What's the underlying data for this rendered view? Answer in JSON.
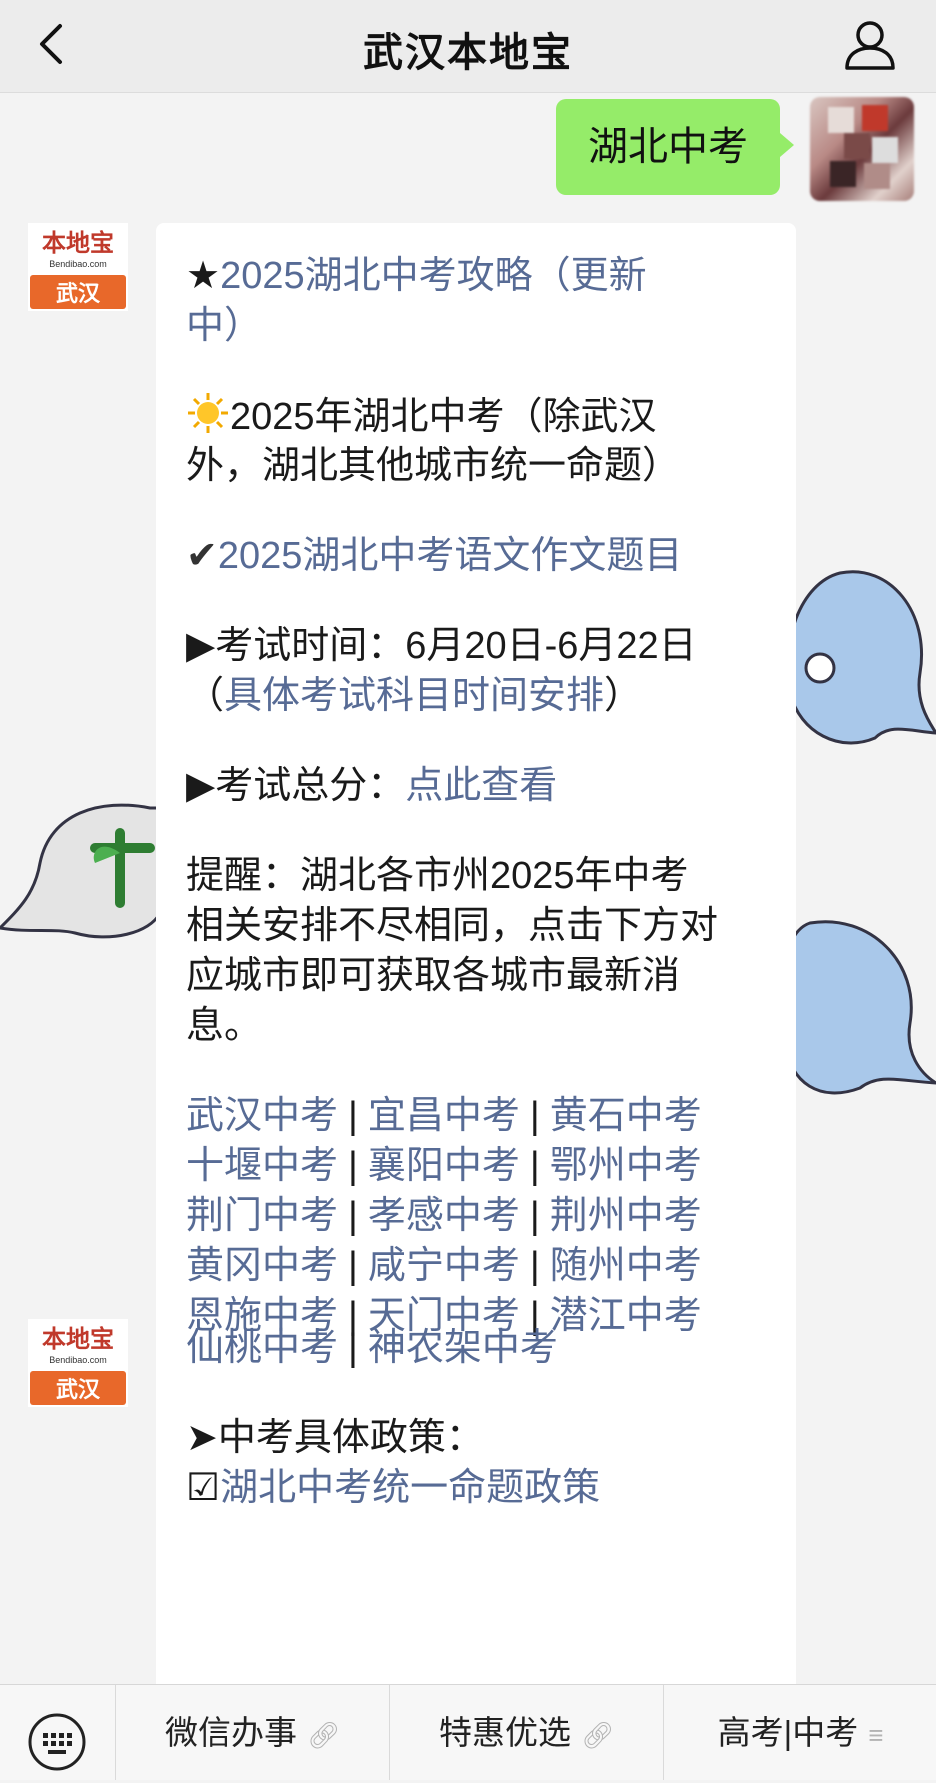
{
  "header": {
    "title": "武汉本地宝"
  },
  "user_message": {
    "text": "湖北中考"
  },
  "bot_avatar": {
    "brand": "本地宝",
    "domain": "Bendibao.com",
    "city": "武汉"
  },
  "message1": {
    "star": "★",
    "guide_link": "2025湖北中考攻略（更新",
    "guide_link_cont": "中）",
    "sun_icon": "sun-emoji",
    "line2a": "2025年湖北中考（除武汉",
    "line2b": "外，湖北其他城市统一命题）",
    "check_icon": "✔",
    "essay_link": "2025湖北中考语文作文题目",
    "time_label": "▶考试时间：6月20日-6月22日",
    "paren_open": "（",
    "schedule_link": "具体考试科目时间安排",
    "paren_close": "）",
    "score_label": "▶考试总分：",
    "score_link": "点此查看",
    "reminder_1": "提醒：湖北各市州2025年中考",
    "reminder_2": "相关安排不尽相同，点击下方对",
    "reminder_3": "应城市即可获取各城市最新消",
    "reminder_4": "息。",
    "separator": "|",
    "cities": [
      [
        "武汉中考",
        "宜昌中考",
        "黄石中考"
      ],
      [
        "十堰中考",
        "襄阳中考",
        "鄂州中考"
      ],
      [
        "荆门中考",
        "孝感中考",
        "荆州中考"
      ],
      [
        "黄冈中考",
        "咸宁中考",
        "随州中考"
      ],
      [
        "恩施中考",
        "天门中考",
        "潜江中考"
      ]
    ]
  },
  "message2": {
    "city_a": "仙桃中考",
    "city_b": "神农架中考",
    "policy_label": "➤中考具体政策：",
    "policy_link": "湖北中考统一命题政策"
  },
  "menu": {
    "items": [
      {
        "label": "微信办事",
        "icon": "link-icon"
      },
      {
        "label": "特惠优选",
        "icon": "link-icon"
      },
      {
        "label": "高考|中考",
        "icon": "menu-lines-icon"
      }
    ]
  }
}
